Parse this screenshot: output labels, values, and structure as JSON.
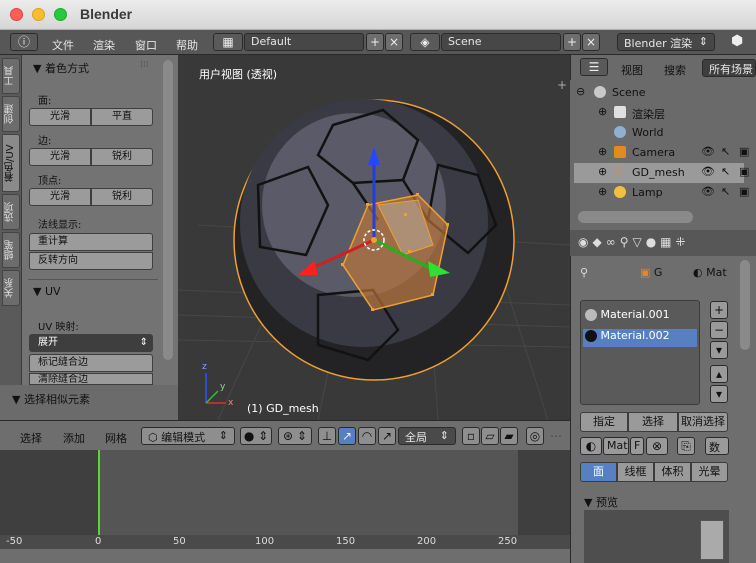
{
  "app_title": "Blender",
  "menu": {
    "items": [
      "文件",
      "渲染",
      "窗口",
      "帮助"
    ]
  },
  "header": {
    "screen_layout": "Default",
    "scene": "Scene",
    "render_engine": "Blender 渲染"
  },
  "toolshelf": {
    "vtabs": [
      "工具",
      "创建",
      "着色/UV",
      "选项",
      "蜡笔",
      "关系"
    ],
    "shading_panel": {
      "title": "着色方式",
      "face_label": "面:",
      "edge_label": "边:",
      "vertex_label": "顶点:",
      "smooth": "光滑",
      "flat": "平直",
      "sharp": "锐利",
      "normals_label": "法线显示:",
      "recalculate": "重计算",
      "flip_direction": "反转方向"
    },
    "uv_panel": {
      "title": "UV",
      "uv_mapping_label": "UV 映射:",
      "unwrap": "展开",
      "mark_seam": "标记缝合边",
      "clear_seam": "清除缝合边"
    },
    "select_similar": "选择相似元素"
  },
  "viewport": {
    "view_label": "用户视图 (透视)",
    "object_label": "(1) GD_mesh",
    "axis_x": "x",
    "axis_y": "y",
    "axis_z": "z"
  },
  "viewport_header": {
    "select": "选择",
    "add": "添加",
    "mesh": "网格",
    "mode": "编辑模式",
    "pivot": "全局"
  },
  "timeline": {
    "ticks": [
      "-50",
      "0",
      "50",
      "100",
      "150",
      "200",
      "250"
    ]
  },
  "outliner": {
    "view": "视图",
    "search": "搜索",
    "filter": "所有场景",
    "items": [
      {
        "name": "Scene",
        "icon": "scene-icon"
      },
      {
        "name": "渲染层",
        "icon": "render-layer-icon"
      },
      {
        "name": "World",
        "icon": "world-icon"
      },
      {
        "name": "Camera",
        "icon": "camera-icon"
      },
      {
        "name": "GD_mesh",
        "icon": "mesh-icon"
      },
      {
        "name": "Lamp",
        "icon": "lamp-icon"
      }
    ]
  },
  "properties": {
    "breadcrumb_object": "G",
    "breadcrumb_material": "Mat",
    "materials": [
      "Material.001",
      "Material.002"
    ],
    "selected_material": "Material.002",
    "assign": "指定",
    "select": "选择",
    "deselect": "取消选择",
    "material_field": "Mat",
    "material_field_f": "F",
    "data_label": "数",
    "tabs": [
      "面",
      "线框",
      "体积",
      "光晕"
    ],
    "preview_title": "预览"
  },
  "colors": {
    "selected_orange": "#f0a030",
    "accent_blue": "#5680c2"
  }
}
